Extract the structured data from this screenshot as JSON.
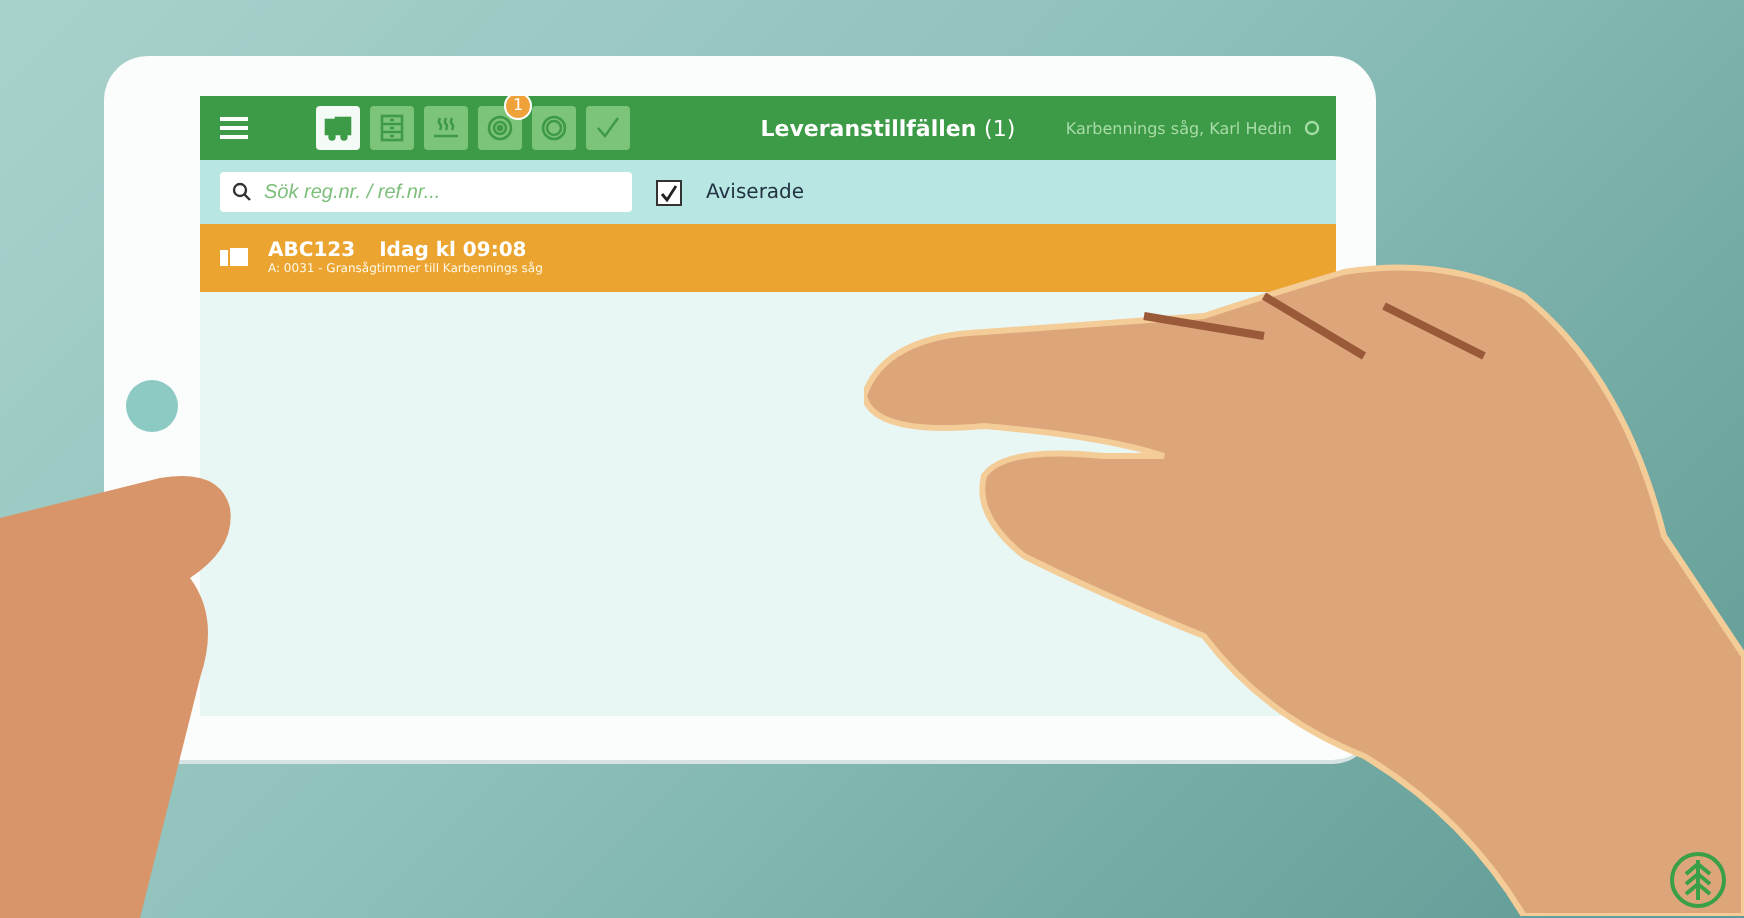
{
  "header": {
    "title": "Leveranstillfällen",
    "count": "(1)",
    "user": "Karbennings såg, Karl Hedin",
    "tabs": [
      {
        "kind": "truck",
        "selected": true
      },
      {
        "kind": "list",
        "selected": false
      },
      {
        "kind": "heat",
        "selected": false
      },
      {
        "kind": "target",
        "selected": false,
        "badge": "1"
      },
      {
        "kind": "coin",
        "selected": false
      },
      {
        "kind": "check",
        "selected": false
      }
    ]
  },
  "search": {
    "placeholder": "Sök reg.nr. / ref.nr..."
  },
  "filter": {
    "label": "Aviserade",
    "checked": true
  },
  "rows": [
    {
      "plate": "ABC123",
      "time": "Idag kl 09:08",
      "detail": "A: 0031 - Gransågtimmer till Karbennings såg"
    }
  ]
}
